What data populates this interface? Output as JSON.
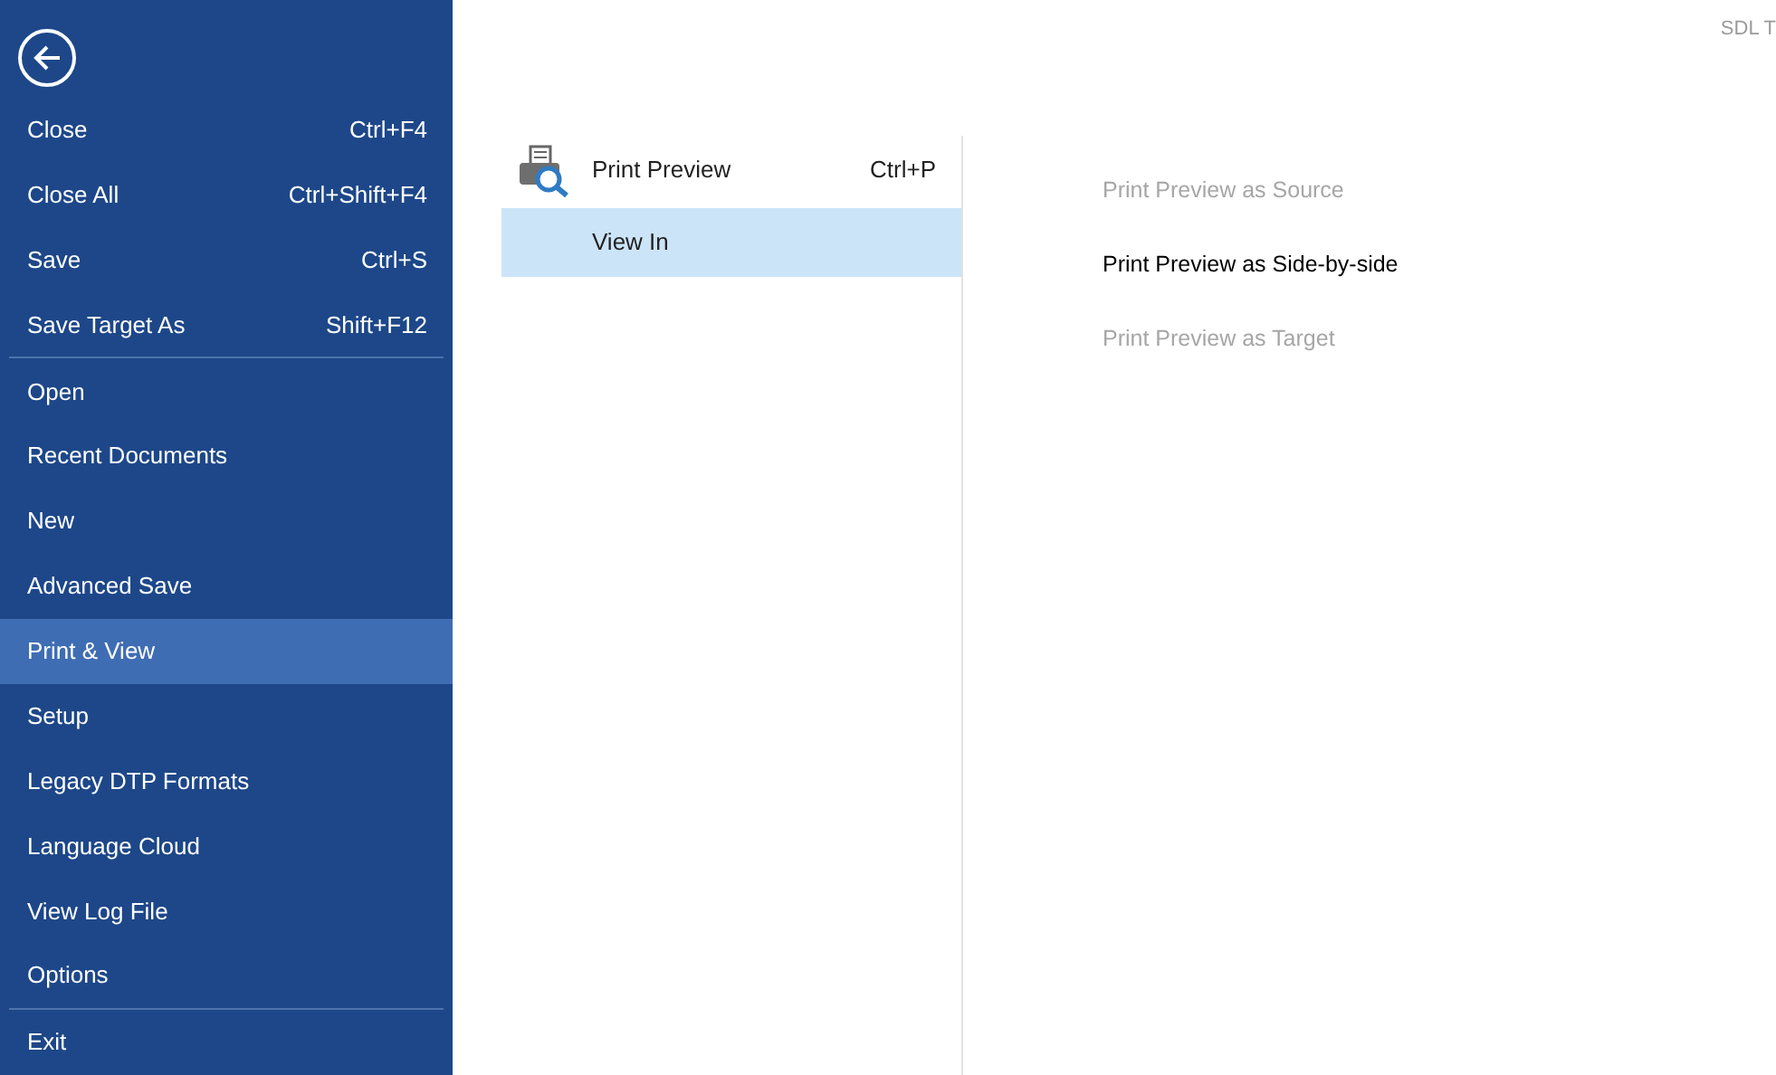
{
  "sidebar": {
    "items": [
      {
        "kind": "item",
        "label": "Close",
        "shortcut": "Ctrl+F4",
        "selected": false
      },
      {
        "kind": "item",
        "label": "Close All",
        "shortcut": "Ctrl+Shift+F4",
        "selected": false
      },
      {
        "kind": "item",
        "label": "Save",
        "shortcut": "Ctrl+S",
        "selected": false
      },
      {
        "kind": "item",
        "label": "Save Target As",
        "shortcut": "Shift+F12",
        "selected": false
      },
      {
        "kind": "separator"
      },
      {
        "kind": "item",
        "label": "Open",
        "selected": false
      },
      {
        "kind": "item",
        "label": "Recent Documents",
        "selected": false
      },
      {
        "kind": "item",
        "label": "New",
        "selected": false
      },
      {
        "kind": "item",
        "label": "Advanced Save",
        "selected": false
      },
      {
        "kind": "item",
        "label": "Print & View",
        "selected": true
      },
      {
        "kind": "item",
        "label": "Setup",
        "selected": false
      },
      {
        "kind": "item",
        "label": "Legacy DTP Formats",
        "selected": false
      },
      {
        "kind": "item",
        "label": "Language Cloud",
        "selected": false
      },
      {
        "kind": "item",
        "label": "View Log File",
        "selected": false
      },
      {
        "kind": "item",
        "label": "Options",
        "selected": false
      },
      {
        "kind": "separator"
      },
      {
        "kind": "item",
        "label": "Exit",
        "selected": false
      }
    ]
  },
  "app_title": "SDL T",
  "commands": [
    {
      "label": "Print Preview",
      "shortcut": "Ctrl+P",
      "icon": true,
      "selected": false
    },
    {
      "label": "View In",
      "icon": false,
      "selected": true
    }
  ],
  "options": [
    {
      "label": "Print Preview as Source",
      "disabled": true
    },
    {
      "label": "Print Preview as Side-by-side",
      "disabled": false
    },
    {
      "label": "Print Preview as Target",
      "disabled": true
    }
  ]
}
